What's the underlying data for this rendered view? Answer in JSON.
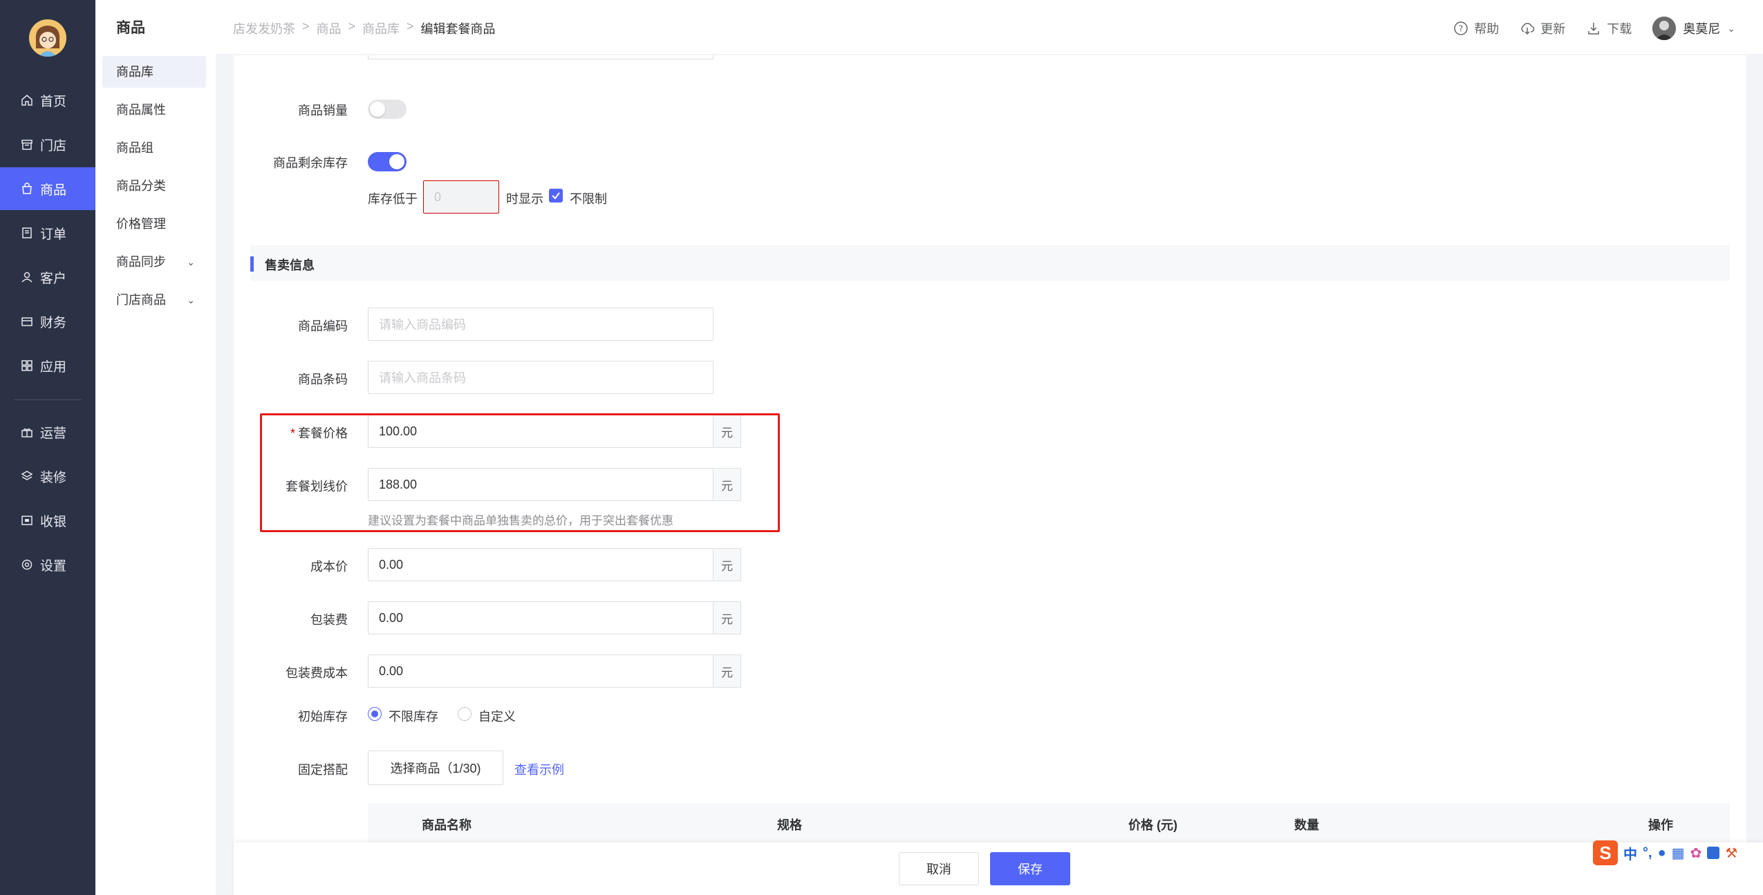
{
  "nav": {
    "items": [
      {
        "label": "首页",
        "icon": "home-icon"
      },
      {
        "label": "门店",
        "icon": "store-icon"
      },
      {
        "label": "商品",
        "icon": "bag-icon",
        "active": true
      },
      {
        "label": "订单",
        "icon": "order-icon"
      },
      {
        "label": "客户",
        "icon": "user-icon"
      },
      {
        "label": "财务",
        "icon": "wallet-icon"
      },
      {
        "label": "应用",
        "icon": "apps-icon"
      },
      {
        "label": "运营",
        "icon": "gift-icon"
      },
      {
        "label": "装修",
        "icon": "layers-icon"
      },
      {
        "label": "收银",
        "icon": "cashier-icon"
      },
      {
        "label": "设置",
        "icon": "gear-icon"
      }
    ]
  },
  "subnav": {
    "title": "商品",
    "items": [
      {
        "label": "商品库",
        "active": true
      },
      {
        "label": "商品属性"
      },
      {
        "label": "商品组"
      },
      {
        "label": "商品分类"
      },
      {
        "label": "价格管理"
      },
      {
        "label": "商品同步",
        "expandable": true
      },
      {
        "label": "门店商品",
        "expandable": true
      }
    ]
  },
  "breadcrumb": [
    "店发发奶茶",
    "商品",
    "商品库",
    "编辑套餐商品"
  ],
  "toolbar": {
    "help": "帮助",
    "update": "更新",
    "download": "下载",
    "user": "奥莫尼"
  },
  "form": {
    "sales_volume_label": "商品销量",
    "sales_volume_on": false,
    "stock_remaining_label": "商品剩余库存",
    "stock_remaining_on": true,
    "stock_below_label": "库存低于",
    "stock_below_value": "0",
    "stock_show_label": "时显示",
    "unlimited_label": "不限制",
    "unlimited_checked": true,
    "section_title": "售卖信息",
    "code_label": "商品编码",
    "code_placeholder": "请输入商品编码",
    "barcode_label": "商品条码",
    "barcode_placeholder": "请输入商品条码",
    "price_label": "套餐价格",
    "price_required": "*",
    "price_value": "100.00",
    "strike_label": "套餐划线价",
    "strike_value": "188.00",
    "strike_hint": "建议设置为套餐中商品单独售卖的总价，用于突出套餐优惠",
    "cost_label": "成本价",
    "cost_value": "0.00",
    "pack_label": "包装费",
    "pack_value": "0.00",
    "pack_cost_label": "包装费成本",
    "pack_cost_value": "0.00",
    "unit": "元",
    "init_stock_label": "初始库存",
    "init_stock_options": [
      "不限库存",
      "自定义"
    ],
    "init_stock_selected": "不限库存",
    "fixed_combo_label": "固定搭配",
    "select_goods_button": "选择商品（1/30)",
    "view_example_link": "查看示例"
  },
  "table": {
    "columns": [
      "商品名称",
      "规格",
      "价格 (元)",
      "数量",
      "操作"
    ]
  },
  "footer": {
    "cancel": "取消",
    "save": "保存"
  },
  "ime": {
    "logo": "S",
    "mode": "中",
    "punct": "°,"
  },
  "colors": {
    "accent": "#5365f6",
    "nav_bg": "#2b3245",
    "highlight": "#e41c1c"
  }
}
